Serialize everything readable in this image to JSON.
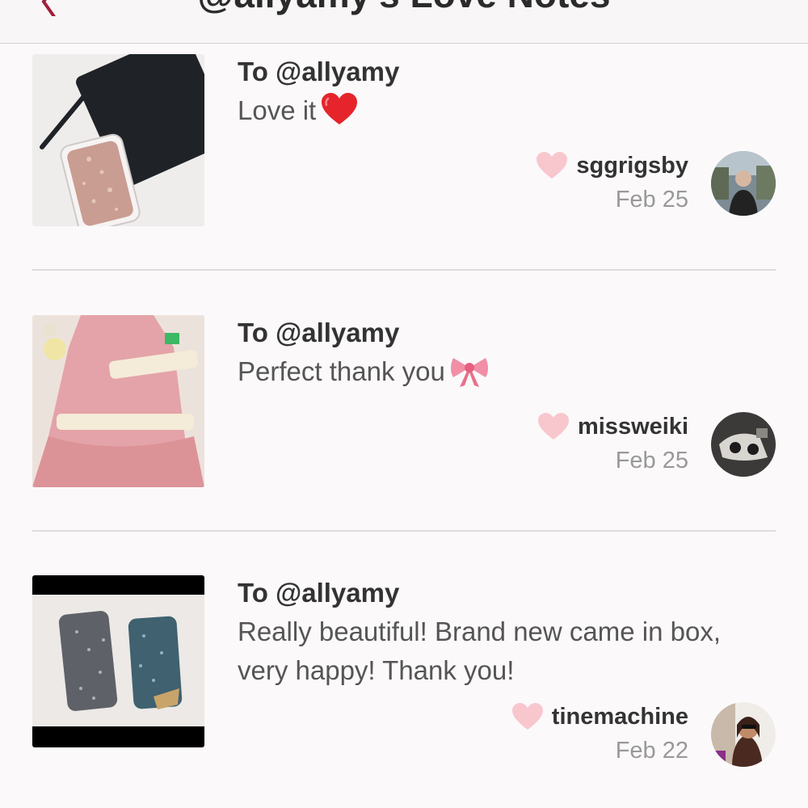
{
  "header": {
    "title": "@allyamy's Love Notes",
    "back_icon": "chevron-left-icon"
  },
  "colors": {
    "heart": "#f8c7ce",
    "back_chevron": "#a01f3c",
    "divider": "#dedcdd"
  },
  "notes": [
    {
      "to": "To @allyamy",
      "message": "Love it",
      "emoji": "red-heart-emoji",
      "username": "sggrigsby",
      "date": "Feb 25"
    },
    {
      "to": "To @allyamy",
      "message": "Perfect thank you",
      "emoji": "pink-ribbon-emoji",
      "username": "missweiki",
      "date": "Feb 25"
    },
    {
      "to": "To @allyamy",
      "message": "Really beautiful! Brand new came in box, very happy! Thank you!",
      "username": "tinemachine",
      "date": "Feb 22"
    }
  ]
}
